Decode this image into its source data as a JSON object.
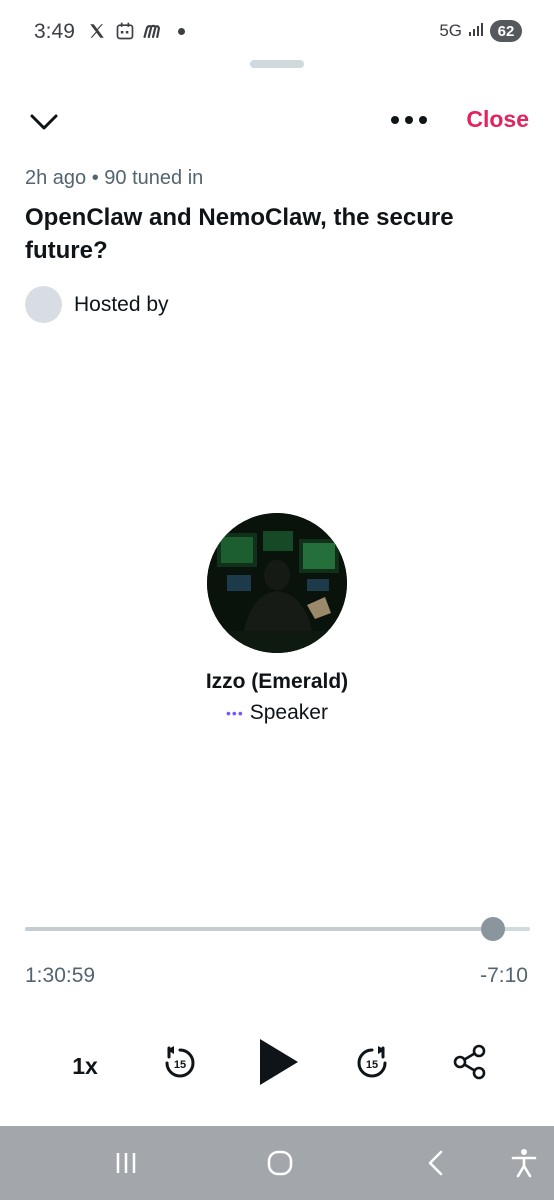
{
  "status_bar": {
    "time": "3:49",
    "network": "5G",
    "battery": "62",
    "icons": [
      "x-logo-icon",
      "calendar-icon",
      "messenger-m-icon",
      "notification-dot-icon",
      "signal-icon"
    ]
  },
  "header": {
    "collapse_icon": "chevron-down-icon",
    "more_icon": "more-horizontal-icon",
    "close_label": "Close"
  },
  "space": {
    "meta": "2h ago • 90 tuned in",
    "title": "OpenClaw and NemoClaw, the secure future?",
    "hosted_by_label": "Hosted by"
  },
  "speaker": {
    "name": "Izzo (Emerald)",
    "role_icon": "audio-dots-icon",
    "role": "Speaker"
  },
  "player": {
    "progress": 0.927,
    "elapsed": "1:30:59",
    "remaining": "-7:10",
    "speed_label": "1x",
    "rewind_seconds": "15",
    "forward_seconds": "15",
    "play_icon": "play-icon",
    "share_icon": "share-icon"
  },
  "nav_bar": {
    "icons": [
      "recent-apps-icon",
      "home-icon",
      "back-icon",
      "accessibility-icon"
    ]
  },
  "colors": {
    "accent_red": "#e0245e",
    "secondary_text": "#536471",
    "role_purple": "#7856ff",
    "nav_bar": "#a3a7ab"
  }
}
